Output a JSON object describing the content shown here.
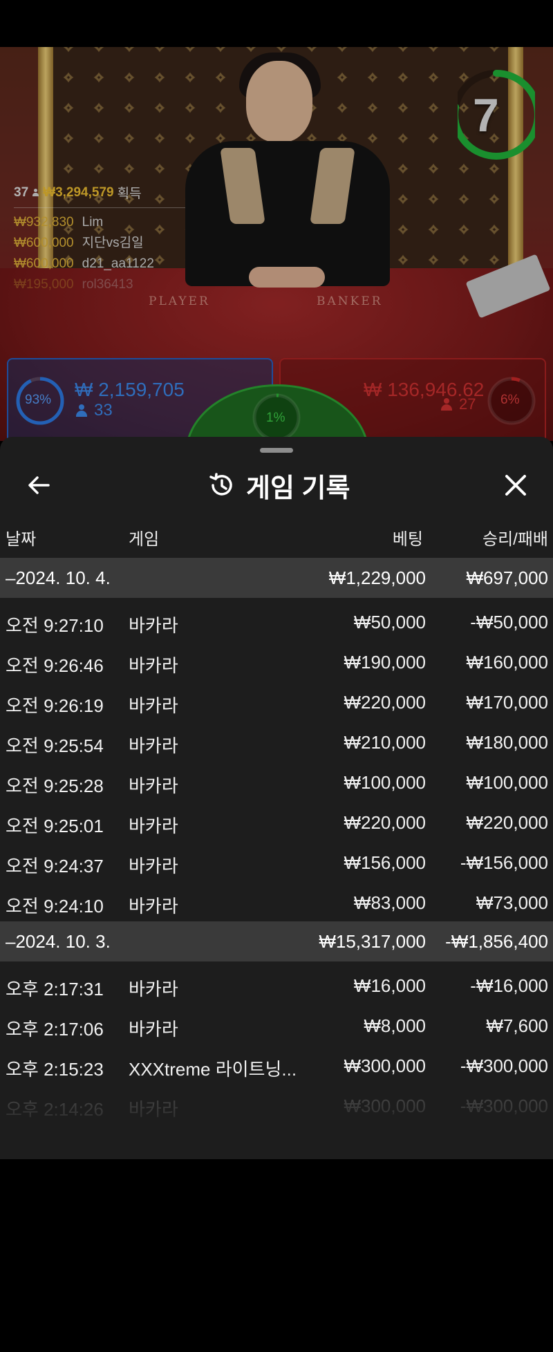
{
  "countdown": {
    "value": "7",
    "progress_fraction": 0.78
  },
  "winners": {
    "count": "37",
    "total": "₩3,294,579",
    "total_suffix": "획득",
    "rows": [
      {
        "amount": "₩932,830",
        "name": "Lim"
      },
      {
        "amount": "₩600,000",
        "name": "지단vs김일"
      },
      {
        "amount": "₩600,000",
        "name": "d21_aa1122"
      },
      {
        "amount": "₩195,000",
        "name": "rol36413"
      }
    ]
  },
  "felt": {
    "player_label": "PLAYER",
    "banker_label": "BANKER"
  },
  "bets": {
    "player": {
      "percent_label": "93%",
      "percent": 0.93,
      "amount": "₩ 2,159,705",
      "count": "33",
      "color": "#2d7be8"
    },
    "tie": {
      "percent_label": "1%",
      "percent": 0.01,
      "color": "#2fbf3a"
    },
    "banker": {
      "percent_label": "6%",
      "percent": 0.06,
      "amount": "₩ 136,946.62",
      "count": "27",
      "color": "#d02a2a"
    }
  },
  "sheet": {
    "title": "게임 기록",
    "icons": {
      "back": "arrow-left-icon",
      "history": "history-icon",
      "close": "close-icon"
    },
    "columns": {
      "date": "날짜",
      "game": "게임",
      "bet": "베팅",
      "result": "승리/패배"
    },
    "groups": [
      {
        "date": "–2024. 10. 4.",
        "bet_total": "₩1,229,000",
        "result_total": "₩697,000",
        "rows": [
          {
            "time": "오전 9:27:10",
            "game": "바카라",
            "bet": "₩50,000",
            "result": "-₩50,000"
          },
          {
            "time": "오전 9:26:46",
            "game": "바카라",
            "bet": "₩190,000",
            "result": "₩160,000"
          },
          {
            "time": "오전 9:26:19",
            "game": "바카라",
            "bet": "₩220,000",
            "result": "₩170,000"
          },
          {
            "time": "오전 9:25:54",
            "game": "바카라",
            "bet": "₩210,000",
            "result": "₩180,000"
          },
          {
            "time": "오전 9:25:28",
            "game": "바카라",
            "bet": "₩100,000",
            "result": "₩100,000"
          },
          {
            "time": "오전 9:25:01",
            "game": "바카라",
            "bet": "₩220,000",
            "result": "₩220,000"
          },
          {
            "time": "오전 9:24:37",
            "game": "바카라",
            "bet": "₩156,000",
            "result": "-₩156,000"
          },
          {
            "time": "오전 9:24:10",
            "game": "바카라",
            "bet": "₩83,000",
            "result": "₩73,000"
          }
        ]
      },
      {
        "date": "–2024. 10. 3.",
        "bet_total": "₩15,317,000",
        "result_total": "-₩1,856,400",
        "rows": [
          {
            "time": "오후 2:17:31",
            "game": "바카라",
            "bet": "₩16,000",
            "result": "-₩16,000"
          },
          {
            "time": "오후 2:17:06",
            "game": "바카라",
            "bet": "₩8,000",
            "result": "₩7,600"
          },
          {
            "time": "오후 2:15:23",
            "game": "XXXtreme 라이트닝...",
            "bet": "₩300,000",
            "result": "-₩300,000"
          },
          {
            "time": "오후 2:14:26",
            "game": "바카라",
            "bet": "₩300,000",
            "result": "-₩300,000"
          }
        ]
      }
    ]
  }
}
